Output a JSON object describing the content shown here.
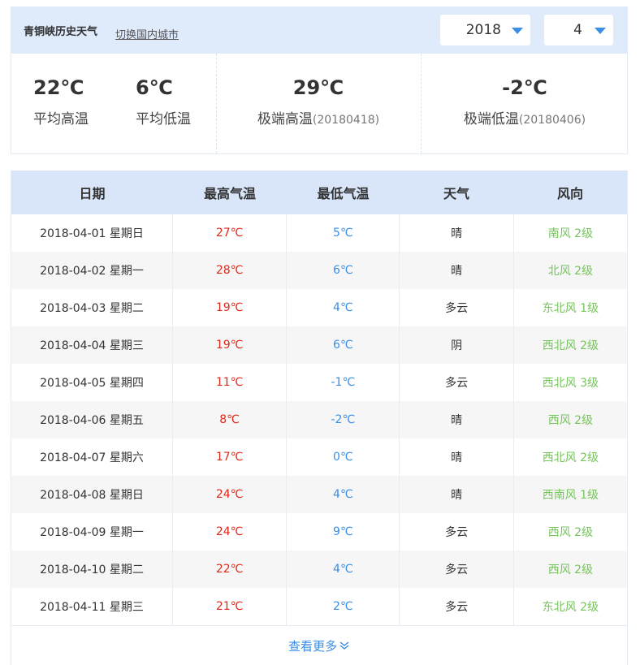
{
  "header": {
    "title": "青铜峡历史天气",
    "switch_city": "切换国内城市",
    "year": "2018",
    "month": "4"
  },
  "summary": {
    "avg_high_value": "22℃",
    "avg_high_label": "平均高温",
    "avg_low_value": "6℃",
    "avg_low_label": "平均低温",
    "max_value": "29℃",
    "max_label": "极端高温",
    "max_date": "(20180418)",
    "min_value": "-2℃",
    "min_label": "极端低温",
    "min_date": "(20180406)"
  },
  "table": {
    "headers": [
      "日期",
      "最高气温",
      "最低气温",
      "天气",
      "风向"
    ],
    "rows": [
      [
        "2018-04-01 星期日",
        "27℃",
        "5℃",
        "晴",
        "南风 2级"
      ],
      [
        "2018-04-02 星期一",
        "28℃",
        "6℃",
        "晴",
        "北风 2级"
      ],
      [
        "2018-04-03 星期二",
        "19℃",
        "4℃",
        "多云",
        "东北风 1级"
      ],
      [
        "2018-04-04 星期三",
        "19℃",
        "6℃",
        "阴",
        "西北风 2级"
      ],
      [
        "2018-04-05 星期四",
        "11℃",
        "-1℃",
        "多云",
        "西北风 3级"
      ],
      [
        "2018-04-06 星期五",
        "8℃",
        "-2℃",
        "晴",
        "西风 2级"
      ],
      [
        "2018-04-07 星期六",
        "17℃",
        "0℃",
        "晴",
        "西北风 2级"
      ],
      [
        "2018-04-08 星期日",
        "24℃",
        "4℃",
        "晴",
        "西南风 1级"
      ],
      [
        "2018-04-09 星期一",
        "24℃",
        "9℃",
        "多云",
        "西风 2级"
      ],
      [
        "2018-04-10 星期二",
        "22℃",
        "4℃",
        "多云",
        "西风 2级"
      ],
      [
        "2018-04-11 星期三",
        "21℃",
        "2℃",
        "多云",
        "东北风 2级"
      ]
    ]
  },
  "more_label": "查看更多",
  "icons": {
    "dropdown": "triangle-down-icon",
    "more": "double-chevron-down-icon"
  },
  "colors": {
    "high": "#e0281a",
    "low": "#3a8ee6",
    "wind": "#76c45c",
    "header_bg": "#dfeafb"
  }
}
